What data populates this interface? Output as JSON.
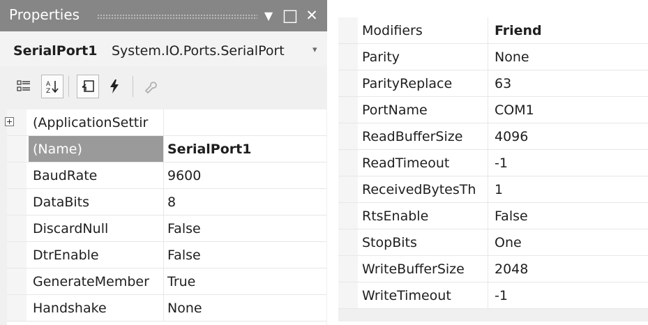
{
  "window": {
    "title": "Properties",
    "controls": {
      "dropdown": "▼",
      "maximize": "□",
      "close": "✕"
    }
  },
  "object_selector": {
    "name": "SerialPort1",
    "type": "System.IO.Ports.SerialPort"
  },
  "toolbar": {
    "buttons": [
      "categorized-icon",
      "alphabetical-icon",
      "properties-icon",
      "events-icon",
      "property-pages-icon"
    ]
  },
  "left_grid": {
    "rows": [
      {
        "name": "(ApplicationSettir",
        "value": ""
      },
      {
        "name": "(Name)",
        "value": "SerialPort1"
      },
      {
        "name": "BaudRate",
        "value": "9600"
      },
      {
        "name": "DataBits",
        "value": "8"
      },
      {
        "name": "DiscardNull",
        "value": "False"
      },
      {
        "name": "DtrEnable",
        "value": "False"
      },
      {
        "name": "GenerateMember",
        "value": "True"
      },
      {
        "name": "Handshake",
        "value": "None"
      }
    ]
  },
  "right_grid": {
    "rows": [
      {
        "name": "Modifiers",
        "value": "Friend"
      },
      {
        "name": "Parity",
        "value": "None"
      },
      {
        "name": "ParityReplace",
        "value": "63"
      },
      {
        "name": "PortName",
        "value": "COM1"
      },
      {
        "name": "ReadBufferSize",
        "value": "4096"
      },
      {
        "name": "ReadTimeout",
        "value": "-1"
      },
      {
        "name": "ReceivedBytesTh",
        "value": "1"
      },
      {
        "name": "RtsEnable",
        "value": "False"
      },
      {
        "name": "StopBits",
        "value": "One"
      },
      {
        "name": "WriteBufferSize",
        "value": "2048"
      },
      {
        "name": "WriteTimeout",
        "value": "-1"
      }
    ]
  },
  "colors": {
    "title_bar": "#868686",
    "selected_row": "#9a9a9a",
    "panel_bg": "#f0f0f0"
  }
}
